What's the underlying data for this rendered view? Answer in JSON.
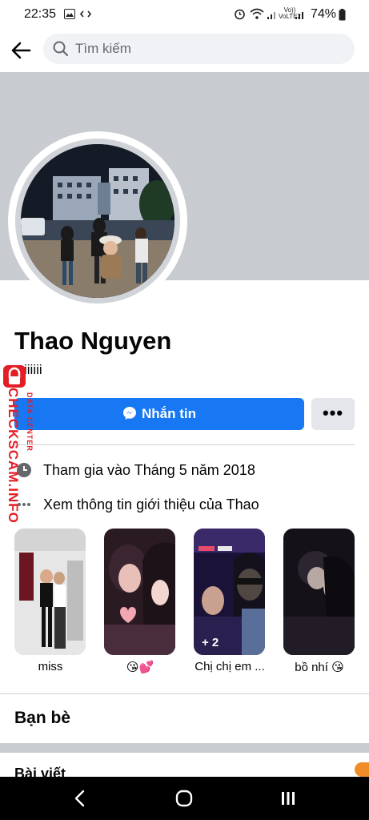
{
  "status_bar": {
    "time": "22:35",
    "battery": "74%",
    "network": "VoLTE2"
  },
  "search": {
    "placeholder": "Tìm kiếm"
  },
  "profile": {
    "name": "Thao Nguyen",
    "bio": "iiiiii",
    "message_button": "Nhắn tin",
    "more_button": "•••"
  },
  "intro": {
    "joined": "Tham gia vào Tháng 5 năm 2018",
    "see_info": "Xem thông tin giới thiệu của Thao"
  },
  "highlights": [
    {
      "caption": "miss",
      "badge": ""
    },
    {
      "caption": "😘💕",
      "badge": ""
    },
    {
      "caption": "Chị chị em ...",
      "badge": "+ 2"
    },
    {
      "caption": "bồ nhí 😘",
      "badge": ""
    }
  ],
  "sections": {
    "friends": "Bạn bè",
    "posts": "Bài viết"
  },
  "watermark": {
    "site": "CHECKSCAM.INFO",
    "tag": "DATA CENTER"
  },
  "colors": {
    "primary": "#1877f2",
    "cover": "#c8cbd0",
    "watermark": "#e41e26"
  }
}
